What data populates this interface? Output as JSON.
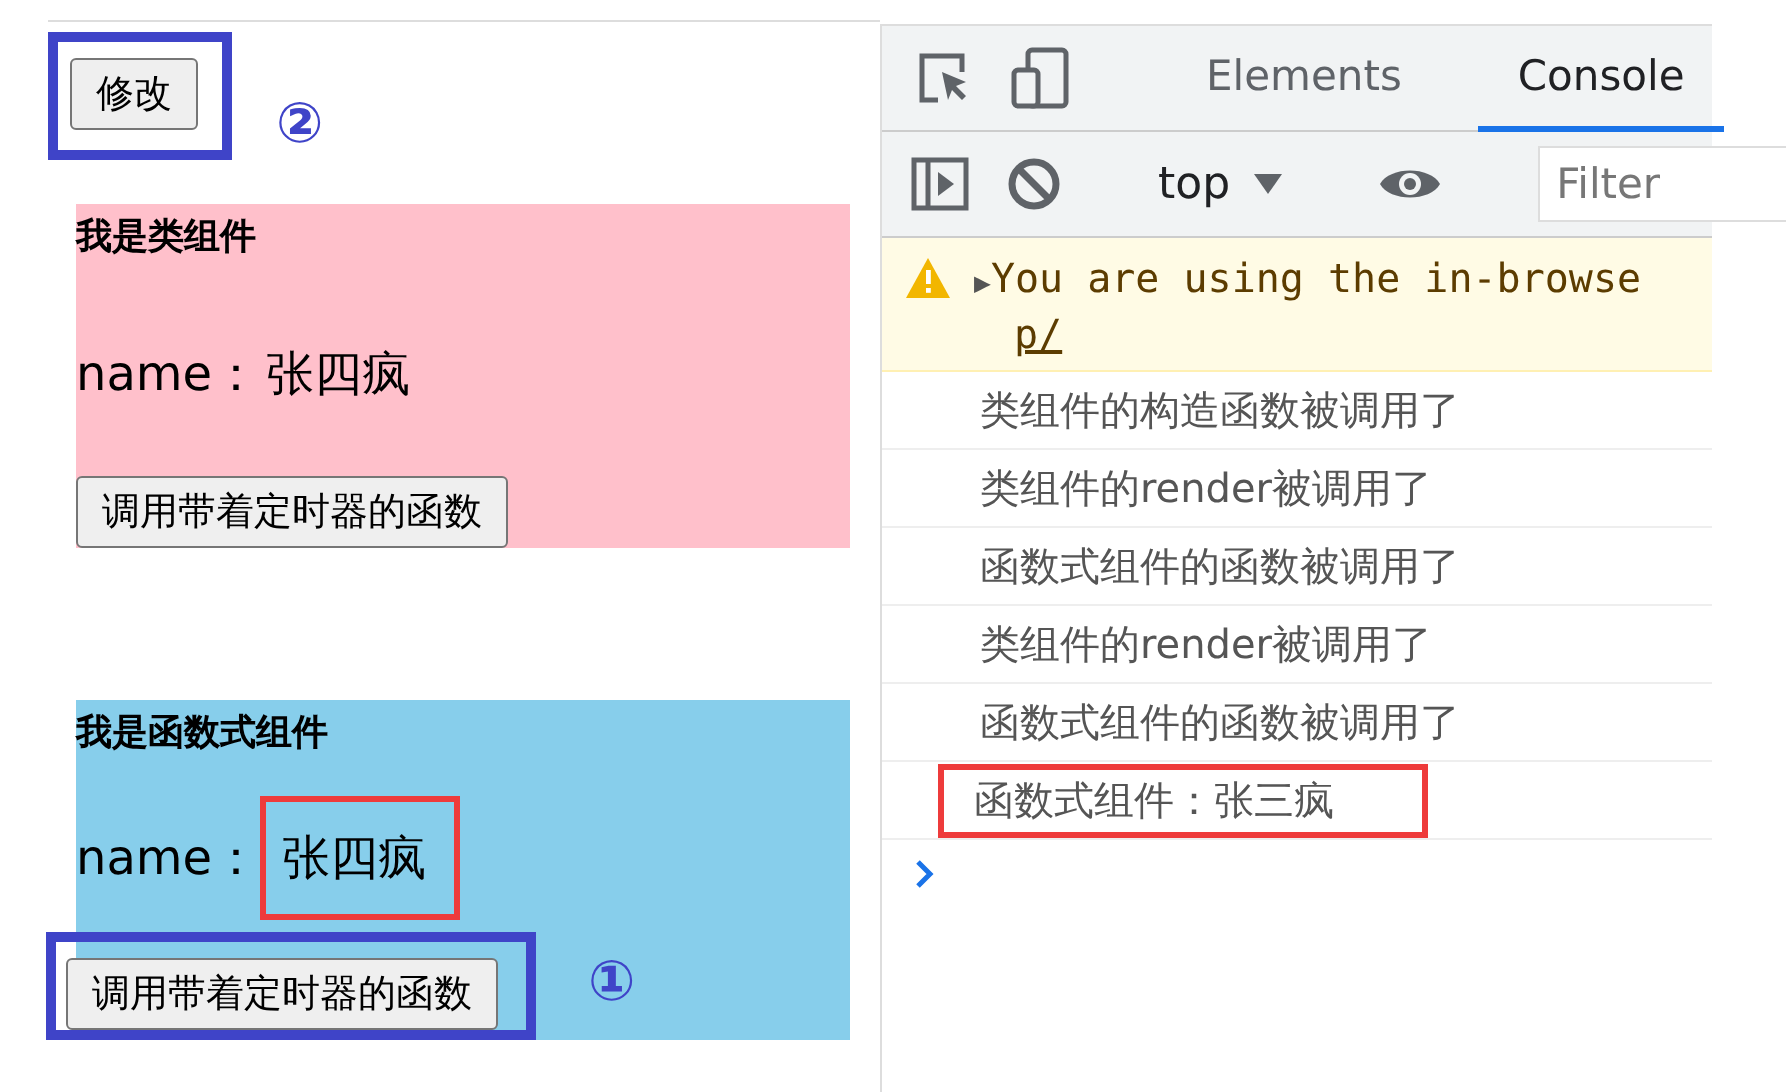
{
  "demo": {
    "modify_button": {
      "label": "修改",
      "highlighted": true,
      "callout": "②"
    },
    "panels": [
      {
        "color": "#ffc0cb",
        "title": "我是类组件",
        "name_label": "name：",
        "name_value": "张四疯",
        "value_highlighted": false,
        "button": "调用带着定时器的函数",
        "button_highlighted": false
      },
      {
        "color": "#87ceeb",
        "title": "我是函数式组件",
        "name_label": "name：",
        "name_value": "张四疯",
        "value_highlighted": true,
        "button": "调用带着定时器的函数",
        "button_highlighted": true,
        "callout": "①"
      }
    ]
  },
  "devtools": {
    "tabs": [
      {
        "label": "Elements",
        "selected": false
      },
      {
        "label": "Console",
        "selected": true
      }
    ],
    "toolbar": {
      "context": "top",
      "filter_placeholder": "Filter"
    },
    "messages": [
      {
        "kind": "warning",
        "expander": "▶",
        "text": "You are using the in-browse",
        "continuation": "p/"
      },
      {
        "kind": "log",
        "text": "类组件的构造函数被调用了",
        "highlighted": false
      },
      {
        "kind": "log",
        "text": "类组件的render被调用了",
        "highlighted": false
      },
      {
        "kind": "log",
        "text": "函数式组件的函数被调用了",
        "highlighted": false
      },
      {
        "kind": "log",
        "text": "类组件的render被调用了",
        "highlighted": false
      },
      {
        "kind": "log",
        "text": "函数式组件的函数被调用了",
        "highlighted": false
      },
      {
        "kind": "log",
        "text": "函数式组件：张三疯",
        "highlighted": true
      }
    ]
  }
}
